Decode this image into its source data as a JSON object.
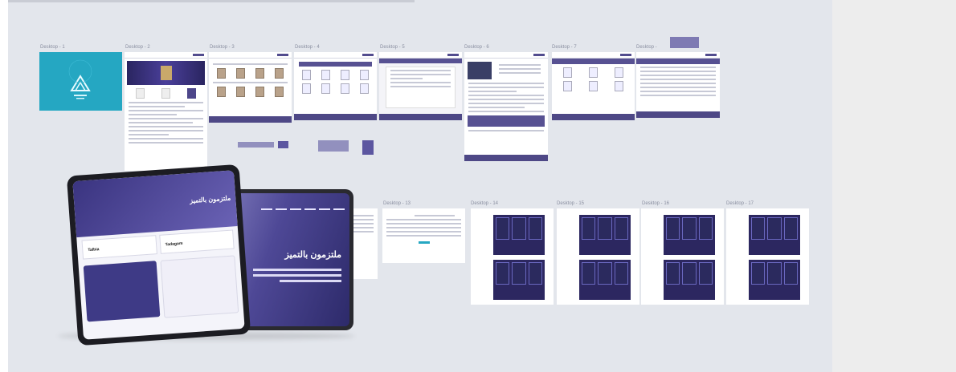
{
  "frames": [
    {
      "id": "d1",
      "label": "Desktop - 1"
    },
    {
      "id": "d2",
      "label": "Desktop - 2"
    },
    {
      "id": "d3",
      "label": "Desktop - 3"
    },
    {
      "id": "d4",
      "label": "Desktop - 4"
    },
    {
      "id": "d5",
      "label": "Desktop - 5"
    },
    {
      "id": "d6",
      "label": "Desktop - 6"
    },
    {
      "id": "d7",
      "label": "Desktop - 7"
    },
    {
      "id": "d8",
      "label": "Desktop -"
    },
    {
      "id": "d13",
      "label": "Desktop - 13"
    },
    {
      "id": "d14",
      "label": "Desktop - 14"
    },
    {
      "id": "d15",
      "label": "Desktop - 15"
    },
    {
      "id": "d16",
      "label": "Desktop - 16"
    },
    {
      "id": "d17",
      "label": "Desktop - 17"
    }
  ],
  "mockup": {
    "back_tablet_title": "ملتزمون بالتميز",
    "front_tablet_hero": "ملتزمون بالتميز",
    "front_tablet_app1": "Talbia",
    "front_tablet_app2": "Tadagom"
  },
  "colors": {
    "canvas": "#e3e6ec",
    "brand_purple": "#575192",
    "teal": "#25a7c2",
    "dark_navy": "#2c2760"
  }
}
